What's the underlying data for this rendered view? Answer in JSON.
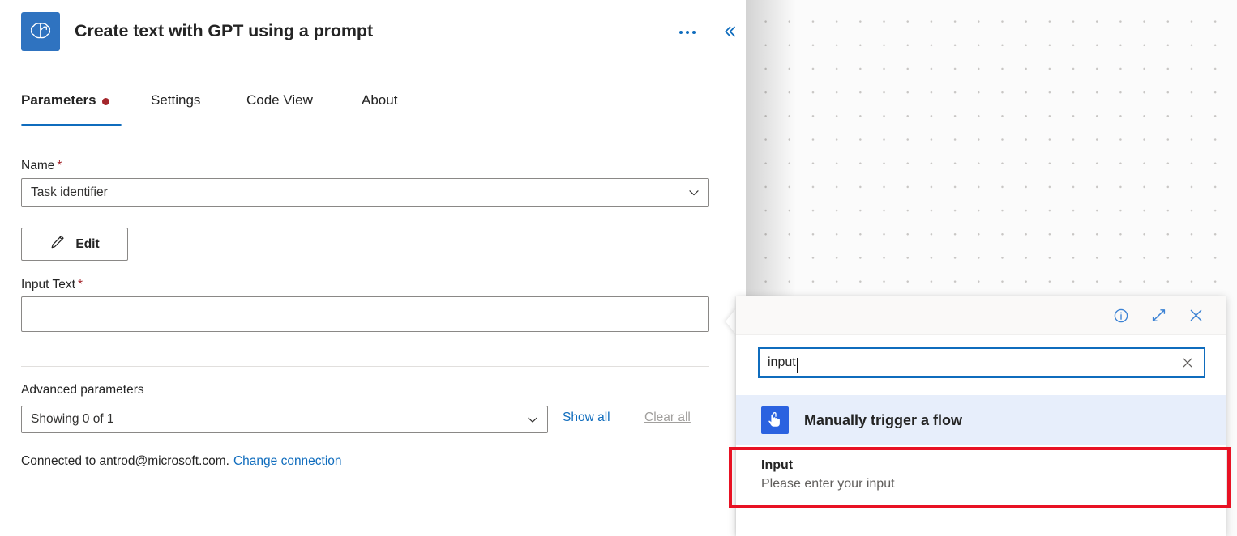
{
  "card": {
    "title": "Create text with GPT using a prompt",
    "app_icon": "brain-icon",
    "more_options_icon": "ellipsis-icon",
    "collapse_icon": "double-chevron-left-icon"
  },
  "tabs": [
    {
      "label": "Parameters",
      "active": true,
      "has_dot_badge": true
    },
    {
      "label": "Settings",
      "active": false,
      "has_dot_badge": false
    },
    {
      "label": "Code View",
      "active": false,
      "has_dot_badge": false
    },
    {
      "label": "About",
      "active": false,
      "has_dot_badge": false
    }
  ],
  "form": {
    "name_label": "Name",
    "name_required_marker": "*",
    "name_value": "Task identifier",
    "edit_button_label": "Edit",
    "edit_button_icon": "pencil-icon",
    "input_text_label": "Input Text",
    "input_text_required_marker": "*",
    "input_text_value": "",
    "advanced_label": "Advanced parameters",
    "advanced_value": "Showing 0 of 1",
    "show_all_label": "Show all",
    "clear_all_label": "Clear all",
    "connection_text": "Connected to antrod@microsoft.com.",
    "change_connection_label": "Change connection"
  },
  "flyout": {
    "info_icon": "info-circle-icon",
    "expand_icon": "expand-diagonal-icon",
    "close_icon": "close-x-icon",
    "search": {
      "value": "input",
      "placeholder": "Search",
      "clear_icon": "clear-x-icon"
    },
    "group": {
      "label": "Manually trigger a flow",
      "icon": "tap-hand-icon"
    },
    "result": {
      "title": "Input",
      "subtitle": "Please enter your input"
    }
  },
  "colors": {
    "accent_blue": "#0f6cbd",
    "icon_blue": "#2f73c0",
    "trigger_blue": "#2b62e0",
    "group_highlight_bg": "#e7eefb",
    "required_red": "#a4262c",
    "tab_badge_red": "#a4262c",
    "highlight_rect_red": "#e81123",
    "border_grey": "#8a8886",
    "subtitle_grey": "#605e5c",
    "disabled_grey": "#a19f9d"
  }
}
